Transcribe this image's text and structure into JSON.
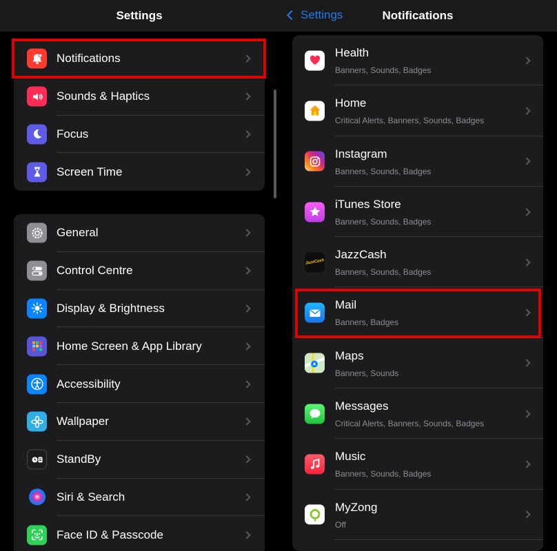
{
  "left": {
    "title": "Settings",
    "group1": [
      {
        "label": "Notifications",
        "icon": "bell-icon",
        "color": "#ff3b30"
      },
      {
        "label": "Sounds & Haptics",
        "icon": "speaker-icon",
        "color": "#ff2d55"
      },
      {
        "label": "Focus",
        "icon": "moon-icon",
        "color": "#5e5ce6"
      },
      {
        "label": "Screen Time",
        "icon": "hourglass-icon",
        "color": "#5e5ce6"
      }
    ],
    "group2": [
      {
        "label": "General",
        "icon": "gear-icon",
        "color": "#8e8e93"
      },
      {
        "label": "Control Centre",
        "icon": "toggles-icon",
        "color": "#8e8e93"
      },
      {
        "label": "Display & Brightness",
        "icon": "sun-icon",
        "color": "#0a84ff"
      },
      {
        "label": "Home Screen & App Library",
        "icon": "app-grid-icon",
        "color": "#5856d6"
      },
      {
        "label": "Accessibility",
        "icon": "accessibility-icon",
        "color": "#0a84ff"
      },
      {
        "label": "Wallpaper",
        "icon": "flower-icon",
        "color": "#32ade6"
      },
      {
        "label": "StandBy",
        "icon": "standby-icon",
        "color": "#1c1c1e"
      },
      {
        "label": "Siri & Search",
        "icon": "siri-icon",
        "color": "#2c2c2e"
      },
      {
        "label": "Face ID & Passcode",
        "icon": "face-id-icon",
        "color": "#30d158"
      }
    ]
  },
  "right": {
    "back_label": "Settings",
    "title": "Notifications",
    "apps": [
      {
        "name": "Health",
        "sub": "Banners, Sounds, Badges",
        "icon": "health-icon"
      },
      {
        "name": "Home",
        "sub": "Critical Alerts, Banners, Sounds, Badges",
        "icon": "home-icon"
      },
      {
        "name": "Instagram",
        "sub": "Banners, Sounds, Badges",
        "icon": "instagram-icon"
      },
      {
        "name": "iTunes Store",
        "sub": "Banners, Sounds, Badges",
        "icon": "itunes-star-icon"
      },
      {
        "name": "JazzCash",
        "sub": "Banners, Sounds, Badges",
        "icon": "jazzcash-icon",
        "icon_text": "JazzCash"
      },
      {
        "name": "Mail",
        "sub": "Banners, Badges",
        "icon": "mail-icon"
      },
      {
        "name": "Maps",
        "sub": "Banners, Sounds",
        "icon": "maps-icon"
      },
      {
        "name": "Messages",
        "sub": "Critical Alerts, Banners, Sounds, Badges",
        "icon": "messages-icon"
      },
      {
        "name": "Music",
        "sub": "Banners, Sounds, Badges",
        "icon": "music-icon"
      },
      {
        "name": "MyZong",
        "sub": "Off",
        "icon": "myzong-icon"
      }
    ]
  },
  "colors": {
    "highlight": "#e00000",
    "accent": "#1e7cf2"
  }
}
